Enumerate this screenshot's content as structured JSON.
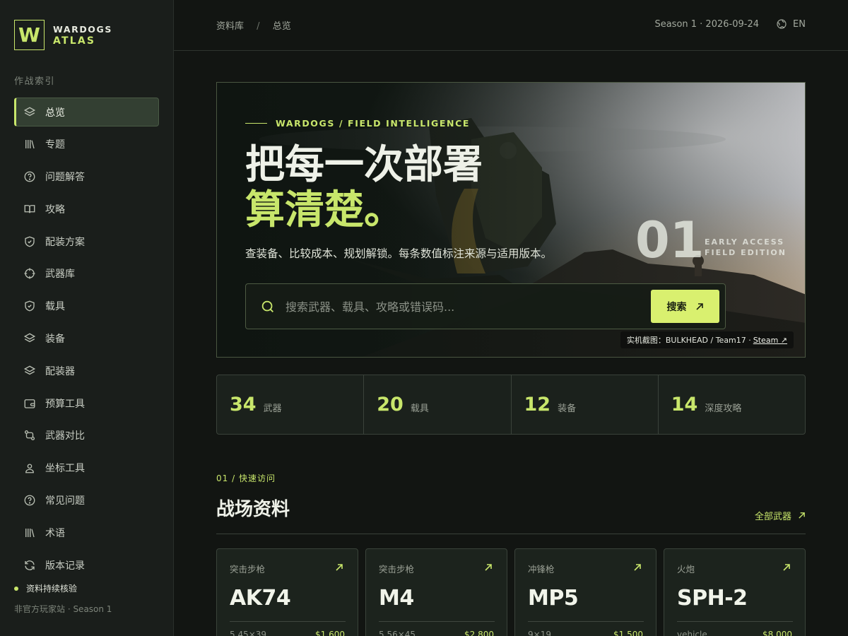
{
  "brand": {
    "mark": "W",
    "line1": "WARDOGS",
    "line2": "ATLAS"
  },
  "sidebar": {
    "section_label": "作战索引",
    "items": [
      {
        "label": "总览",
        "icon": "layers-icon",
        "active": true
      },
      {
        "label": "专题",
        "icon": "library-icon"
      },
      {
        "label": "问题解答",
        "icon": "help-circle-icon"
      },
      {
        "label": "攻略",
        "icon": "book-open-icon"
      },
      {
        "label": "配装方案",
        "icon": "shield-check-icon"
      },
      {
        "label": "武器库",
        "icon": "crosshair-icon"
      },
      {
        "label": "载具",
        "icon": "shield-check-icon"
      },
      {
        "label": "装备",
        "icon": "layers-icon"
      },
      {
        "label": "配装器",
        "icon": "layers-icon"
      },
      {
        "label": "预算工具",
        "icon": "wallet-icon"
      },
      {
        "label": "武器对比",
        "icon": "compare-icon"
      },
      {
        "label": "坐标工具",
        "icon": "map-pin-user-icon"
      },
      {
        "label": "常见问题",
        "icon": "help-circle-icon"
      },
      {
        "label": "术语",
        "icon": "library-icon"
      },
      {
        "label": "版本记录",
        "icon": "refresh-icon"
      }
    ],
    "status": "资料持续核验",
    "footer_note": "非官方玩家站 · Season 1"
  },
  "topbar": {
    "breadcrumb": [
      "资料库",
      "总览"
    ],
    "breadcrumb_separator": "/",
    "season": "Season 1 · 2026-09-24",
    "language": "EN"
  },
  "hero": {
    "kicker": "WARDOGS / FIELD INTELLIGENCE",
    "title_line1": "把每一次部署",
    "title_line2": "算清楚。",
    "subtitle": "查装备、比较成本、规划解锁。每条数值标注来源与适用版本。",
    "number": "01",
    "number_label_1": "EARLY ACCESS",
    "number_label_2": "FIELD EDITION",
    "search_placeholder": "搜索武器、载具、攻略或错误码...",
    "search_button": "搜索",
    "credit_prefix": "实机截图：BULKHEAD / Team17 ·",
    "credit_link": "Steam ↗"
  },
  "stats": [
    {
      "value": "34",
      "label": "武器"
    },
    {
      "value": "20",
      "label": "载具"
    },
    {
      "value": "12",
      "label": "装备"
    },
    {
      "value": "14",
      "label": "深度攻略"
    }
  ],
  "section": {
    "kicker": "01 / 快速访问",
    "title": "战场资料",
    "link": "全部武器"
  },
  "cards": [
    {
      "category": "突击步枪",
      "name": "AK74",
      "spec": "5.45×39",
      "price": "$1,600"
    },
    {
      "category": "突击步枪",
      "name": "M4",
      "spec": "5.56×45",
      "price": "$2,800"
    },
    {
      "category": "冲锋枪",
      "name": "MP5",
      "spec": "9×19",
      "price": "$1,500"
    },
    {
      "category": "火炮",
      "name": "SPH-2",
      "spec": "vehicle",
      "price": "$8,000"
    }
  ],
  "colors": {
    "accent": "#c8e66b",
    "background": "#121512",
    "sidebar": "#1a1e1b",
    "button": "#d9f06f"
  }
}
